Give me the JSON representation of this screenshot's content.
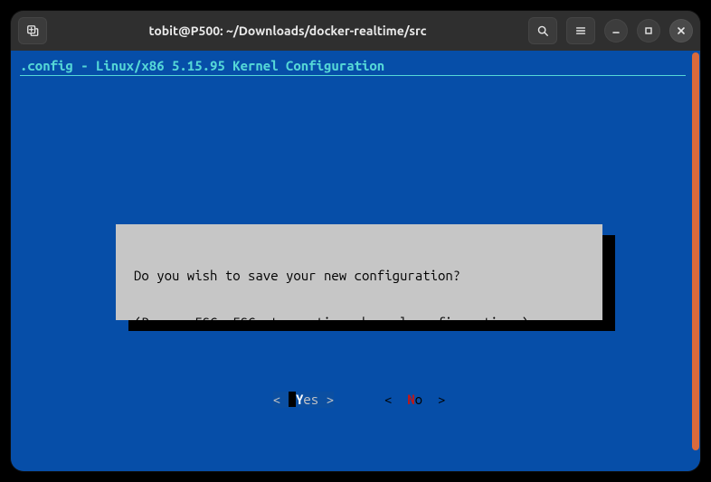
{
  "window": {
    "title": "tobit@P500: ~/Downloads/docker-realtime/src"
  },
  "header": {
    "line": ".config - Linux/x86 5.15.95 Kernel Configuration"
  },
  "dialog": {
    "line1": "Do you wish to save your new configuration?",
    "line2": "(Press <ESC><ESC> to continue kernel configuration.)",
    "yes": {
      "open": "< ",
      "hot": "Y",
      "rest": "es ",
      "close": ">"
    },
    "no": {
      "open": "<  ",
      "hot": "N",
      "rest": "o ",
      "close": " >"
    }
  }
}
